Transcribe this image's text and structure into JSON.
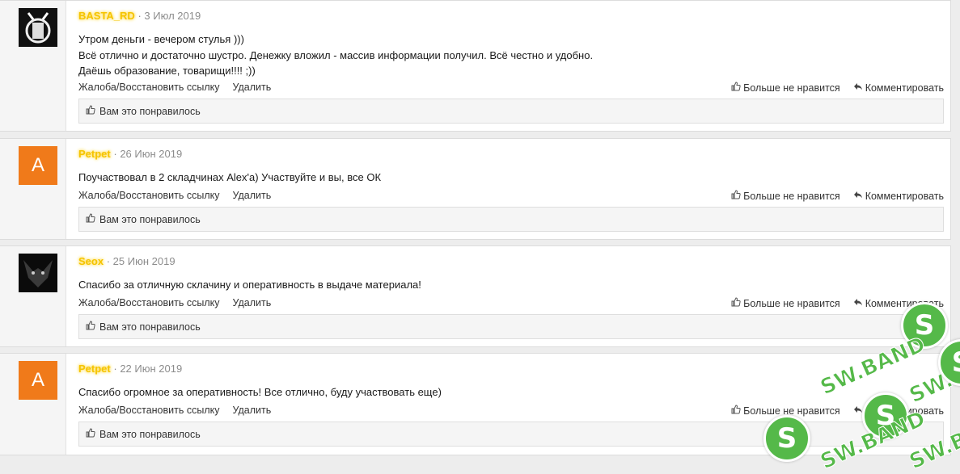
{
  "comments": [
    {
      "username": "BASTA_RD",
      "date": "3 Июл 2019",
      "avatar_letter": "",
      "avatar_kind": "image",
      "lines": [
        "Утром деньги - вечером стулья )))",
        "Всё отлично и достаточно шустро. Денежку вложил - массив информации получил. Всё честно и удобно.",
        "Даёшь образование, товарищи!!!! ;))"
      ]
    },
    {
      "username": "Petpet",
      "date": "26 Июн 2019",
      "avatar_letter": "A",
      "avatar_kind": "letter",
      "lines": [
        "Поучаствовал в 2 складчинах Alex'а) Участвуйте и вы, все ОК"
      ]
    },
    {
      "username": "Seox",
      "date": "25 Июн 2019",
      "avatar_letter": "",
      "avatar_kind": "image",
      "lines": [
        "Спасибо за отличную склачину и оперативность в выдаче материала!"
      ]
    },
    {
      "username": "Petpet",
      "date": "22 Июн 2019",
      "avatar_letter": "A",
      "avatar_kind": "letter",
      "lines": [
        "Спасибо огромное за оперативность! Все отлично, буду участвовать еще)"
      ]
    }
  ],
  "actions": {
    "report": "Жалоба/Восстановить ссылку",
    "delete": "Удалить",
    "unlike": "Больше не нравится",
    "comment": "Комментировать",
    "liked": "Вам это понравилось"
  },
  "separator": "·",
  "watermark": {
    "text": "SW.BAND",
    "glyph": "S",
    "color": "#55b949"
  },
  "colors": {
    "username": "#f5c400",
    "avatar_letter_bg": "#f07a1a"
  }
}
